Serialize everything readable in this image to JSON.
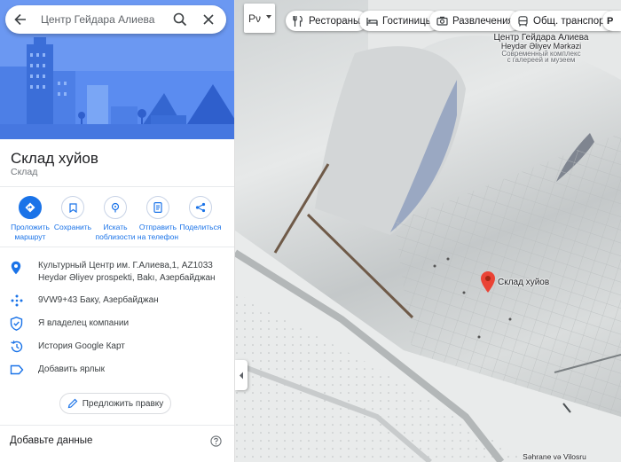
{
  "search": {
    "value": "Центр Гейдара Алиева"
  },
  "place": {
    "title": "Склад хуйов",
    "category": "Склад"
  },
  "actions": [
    {
      "label_line1": "Проложить",
      "label_line2": "маршрут",
      "icon": "directions-icon"
    },
    {
      "label_line1": "Сохранить",
      "label_line2": "",
      "icon": "bookmark-icon"
    },
    {
      "label_line1": "Искать",
      "label_line2": "поблизости",
      "icon": "nearby-search-icon"
    },
    {
      "label_line1": "Отправить",
      "label_line2": "на телефон",
      "icon": "send-to-phone-icon"
    },
    {
      "label_line1": "Поделиться",
      "label_line2": "",
      "icon": "share-icon"
    }
  ],
  "info": {
    "address_line1": "Культурный Центр им. Г.Алиева,1, AZ1033",
    "address_line2": "Heydər Əliyev prospekti, Bakı, Азербайджан",
    "plus_code": "9VW9+43 Баку, Азербайджан",
    "claim": "Я владелец компании",
    "history": "История Google Карт",
    "add_label": "Добавить ярлык"
  },
  "suggest_edit": "Предложить правку",
  "add_data": "Добавьте данные",
  "map": {
    "layer_label": "Рν",
    "chips": [
      {
        "label": "Рестораны",
        "icon": "restaurant-icon"
      },
      {
        "label": "Гостиницы",
        "icon": "hotel-icon"
      },
      {
        "label": "Развлечения",
        "icon": "camera-icon"
      },
      {
        "label": "Общ. транспорт",
        "icon": "transit-icon"
      },
      {
        "label": "Р",
        "icon": "parking-icon"
      }
    ],
    "poi_name_ru": "Центр Гейдара Алиева",
    "poi_name_az": "Heydər Əliyev Mərkəzi",
    "poi_desc_line1": "Современный комплекс",
    "poi_desc_line2": "с галереей и музеем",
    "marker_label": "Склад хуйов",
    "bottom_label": "Səhrane və Vilosru"
  },
  "colors": {
    "accent": "#1a73e8",
    "marker": "#ea4335",
    "hero_bg": "#5b8cf0"
  }
}
